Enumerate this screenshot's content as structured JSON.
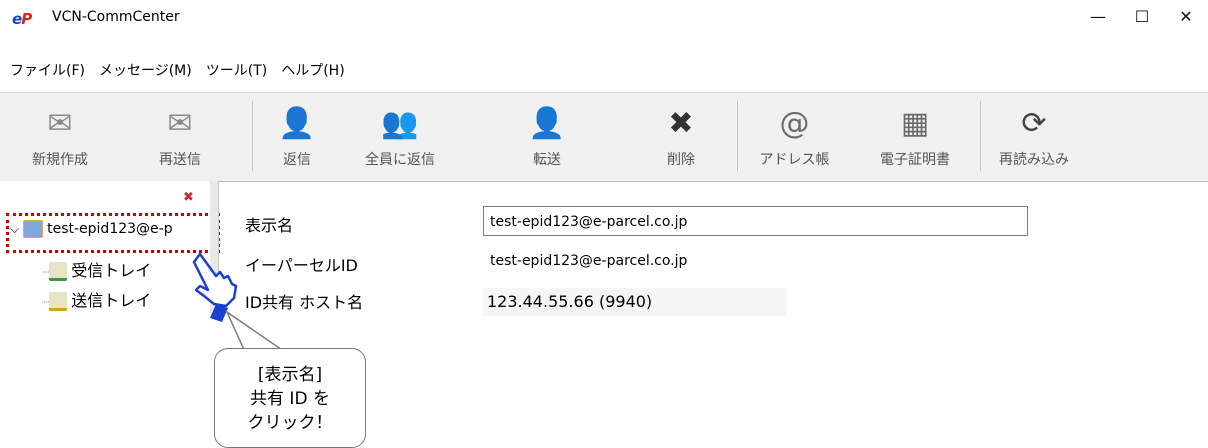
{
  "window": {
    "logo_text": "eP",
    "title": "VCN-CommCenter",
    "minimize_glyph": "—",
    "maximize_glyph": "☐",
    "close_glyph": "✕"
  },
  "menu": [
    "ファイル(F)",
    "メッセージ(M)",
    "ツール(T)",
    "ヘルプ(H)"
  ],
  "toolbar": [
    {
      "label": "新規作成",
      "icon": "new-mail-icon",
      "glyph": "✉"
    },
    {
      "label": "再送信",
      "icon": "resend-icon",
      "glyph": "✉"
    },
    {
      "label": "返信",
      "icon": "reply-icon",
      "glyph": "👤"
    },
    {
      "label": "全員に返信",
      "icon": "reply-all-icon",
      "glyph": "👥"
    },
    {
      "label": "転送",
      "icon": "forward-icon",
      "glyph": "👤"
    },
    {
      "label": "削除",
      "icon": "delete-icon",
      "glyph": "✖"
    },
    {
      "label": "アドレス帳",
      "icon": "address-book-icon",
      "glyph": "@"
    },
    {
      "label": "電子証明書",
      "icon": "certificate-icon",
      "glyph": "▦"
    },
    {
      "label": "再読み込み",
      "icon": "refresh-icon",
      "glyph": "⟳"
    }
  ],
  "tree": {
    "close_glyph": "✖",
    "account": "test-epid123@e-p",
    "inbox": "受信トレイ",
    "outbox": "送信トレイ"
  },
  "details": {
    "display_name_label": "表示名",
    "display_name_value": "test-epid123@e-parcel.co.jp",
    "eparcel_id_label": "イーパーセルID",
    "eparcel_id_value": "test-epid123@e-parcel.co.jp",
    "host_label": "ID共有 ホスト名",
    "host_value": "123.44.55.66 (9940)"
  },
  "callout": {
    "line1": "[表示名]",
    "line2": "共有 ID を",
    "line3": "クリック！"
  },
  "colors": {
    "highlight": "#d00000",
    "toolbar_bg": "#f0f0f0",
    "cursor_blue": "#1a3fd1"
  }
}
